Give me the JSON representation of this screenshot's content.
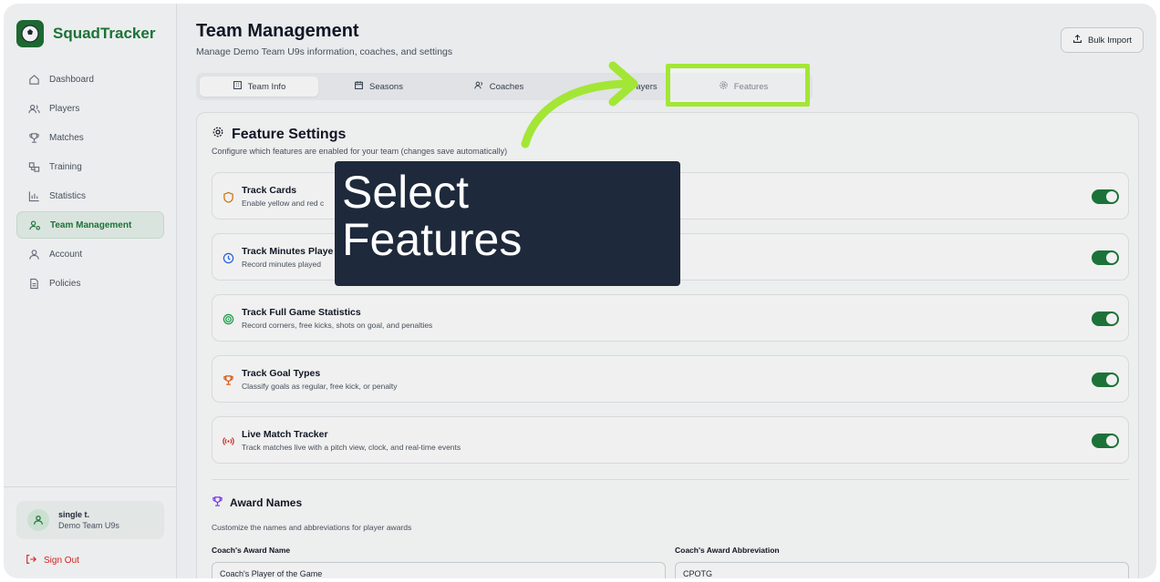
{
  "app": {
    "name": "SquadTracker"
  },
  "sidebar": {
    "items": [
      {
        "label": "Dashboard",
        "icon": "home-icon"
      },
      {
        "label": "Players",
        "icon": "users-icon"
      },
      {
        "label": "Matches",
        "icon": "trophy-icon"
      },
      {
        "label": "Training",
        "icon": "training-icon"
      },
      {
        "label": "Statistics",
        "icon": "bar-chart-icon"
      },
      {
        "label": "Team Management",
        "icon": "team-management-icon",
        "active": true
      },
      {
        "label": "Account",
        "icon": "user-icon"
      },
      {
        "label": "Policies",
        "icon": "document-icon"
      }
    ],
    "user": {
      "name": "single t.",
      "team": "Demo Team U9s"
    },
    "sign_out": "Sign Out"
  },
  "header": {
    "title": "Team Management",
    "subtitle": "Manage Demo Team U9s information, coaches, and settings",
    "bulk_import": "Bulk Import"
  },
  "tabs": [
    {
      "label": "Team Info",
      "active": true
    },
    {
      "label": "Seasons"
    },
    {
      "label": "Coaches"
    },
    {
      "label": "ayers"
    },
    {
      "label": "Features",
      "highlighted": true
    }
  ],
  "feature_settings": {
    "title": "Feature Settings",
    "subtitle": "Configure which features are enabled for your team (changes save automatically)",
    "items": [
      {
        "title": "Track Cards",
        "desc": "Enable yellow and red c",
        "enabled": true,
        "icon": "shield-icon",
        "color": "#d97706"
      },
      {
        "title": "Track Minutes Playe",
        "desc": "Record minutes played",
        "enabled": true,
        "icon": "clock-icon",
        "color": "#2563eb"
      },
      {
        "title": "Track Full Game Statistics",
        "desc": "Record corners, free kicks, shots on goal, and penalties",
        "enabled": true,
        "icon": "target-icon",
        "color": "#16a34a"
      },
      {
        "title": "Track Goal Types",
        "desc": "Classify goals as regular, free kick, or penalty",
        "enabled": true,
        "icon": "trophy-icon",
        "color": "#ea580c"
      },
      {
        "title": "Live Match Tracker",
        "desc": "Track matches live with a pitch view, clock, and real-time events",
        "enabled": true,
        "icon": "broadcast-icon",
        "color": "#dc2626"
      }
    ]
  },
  "award_names": {
    "title": "Award Names",
    "subtitle": "Customize the names and abbreviations for player awards",
    "fields": [
      {
        "label": "Coach's Award Name",
        "value": "Coach's Player of the Game"
      },
      {
        "label": "Coach's Award Abbreviation",
        "value": "CPOTG"
      }
    ]
  },
  "callout": {
    "line1": "Select",
    "line2": "Features"
  },
  "colors": {
    "brand": "#1e7a3c",
    "highlight": "#a3e635",
    "callout_bg": "#1e293b"
  }
}
